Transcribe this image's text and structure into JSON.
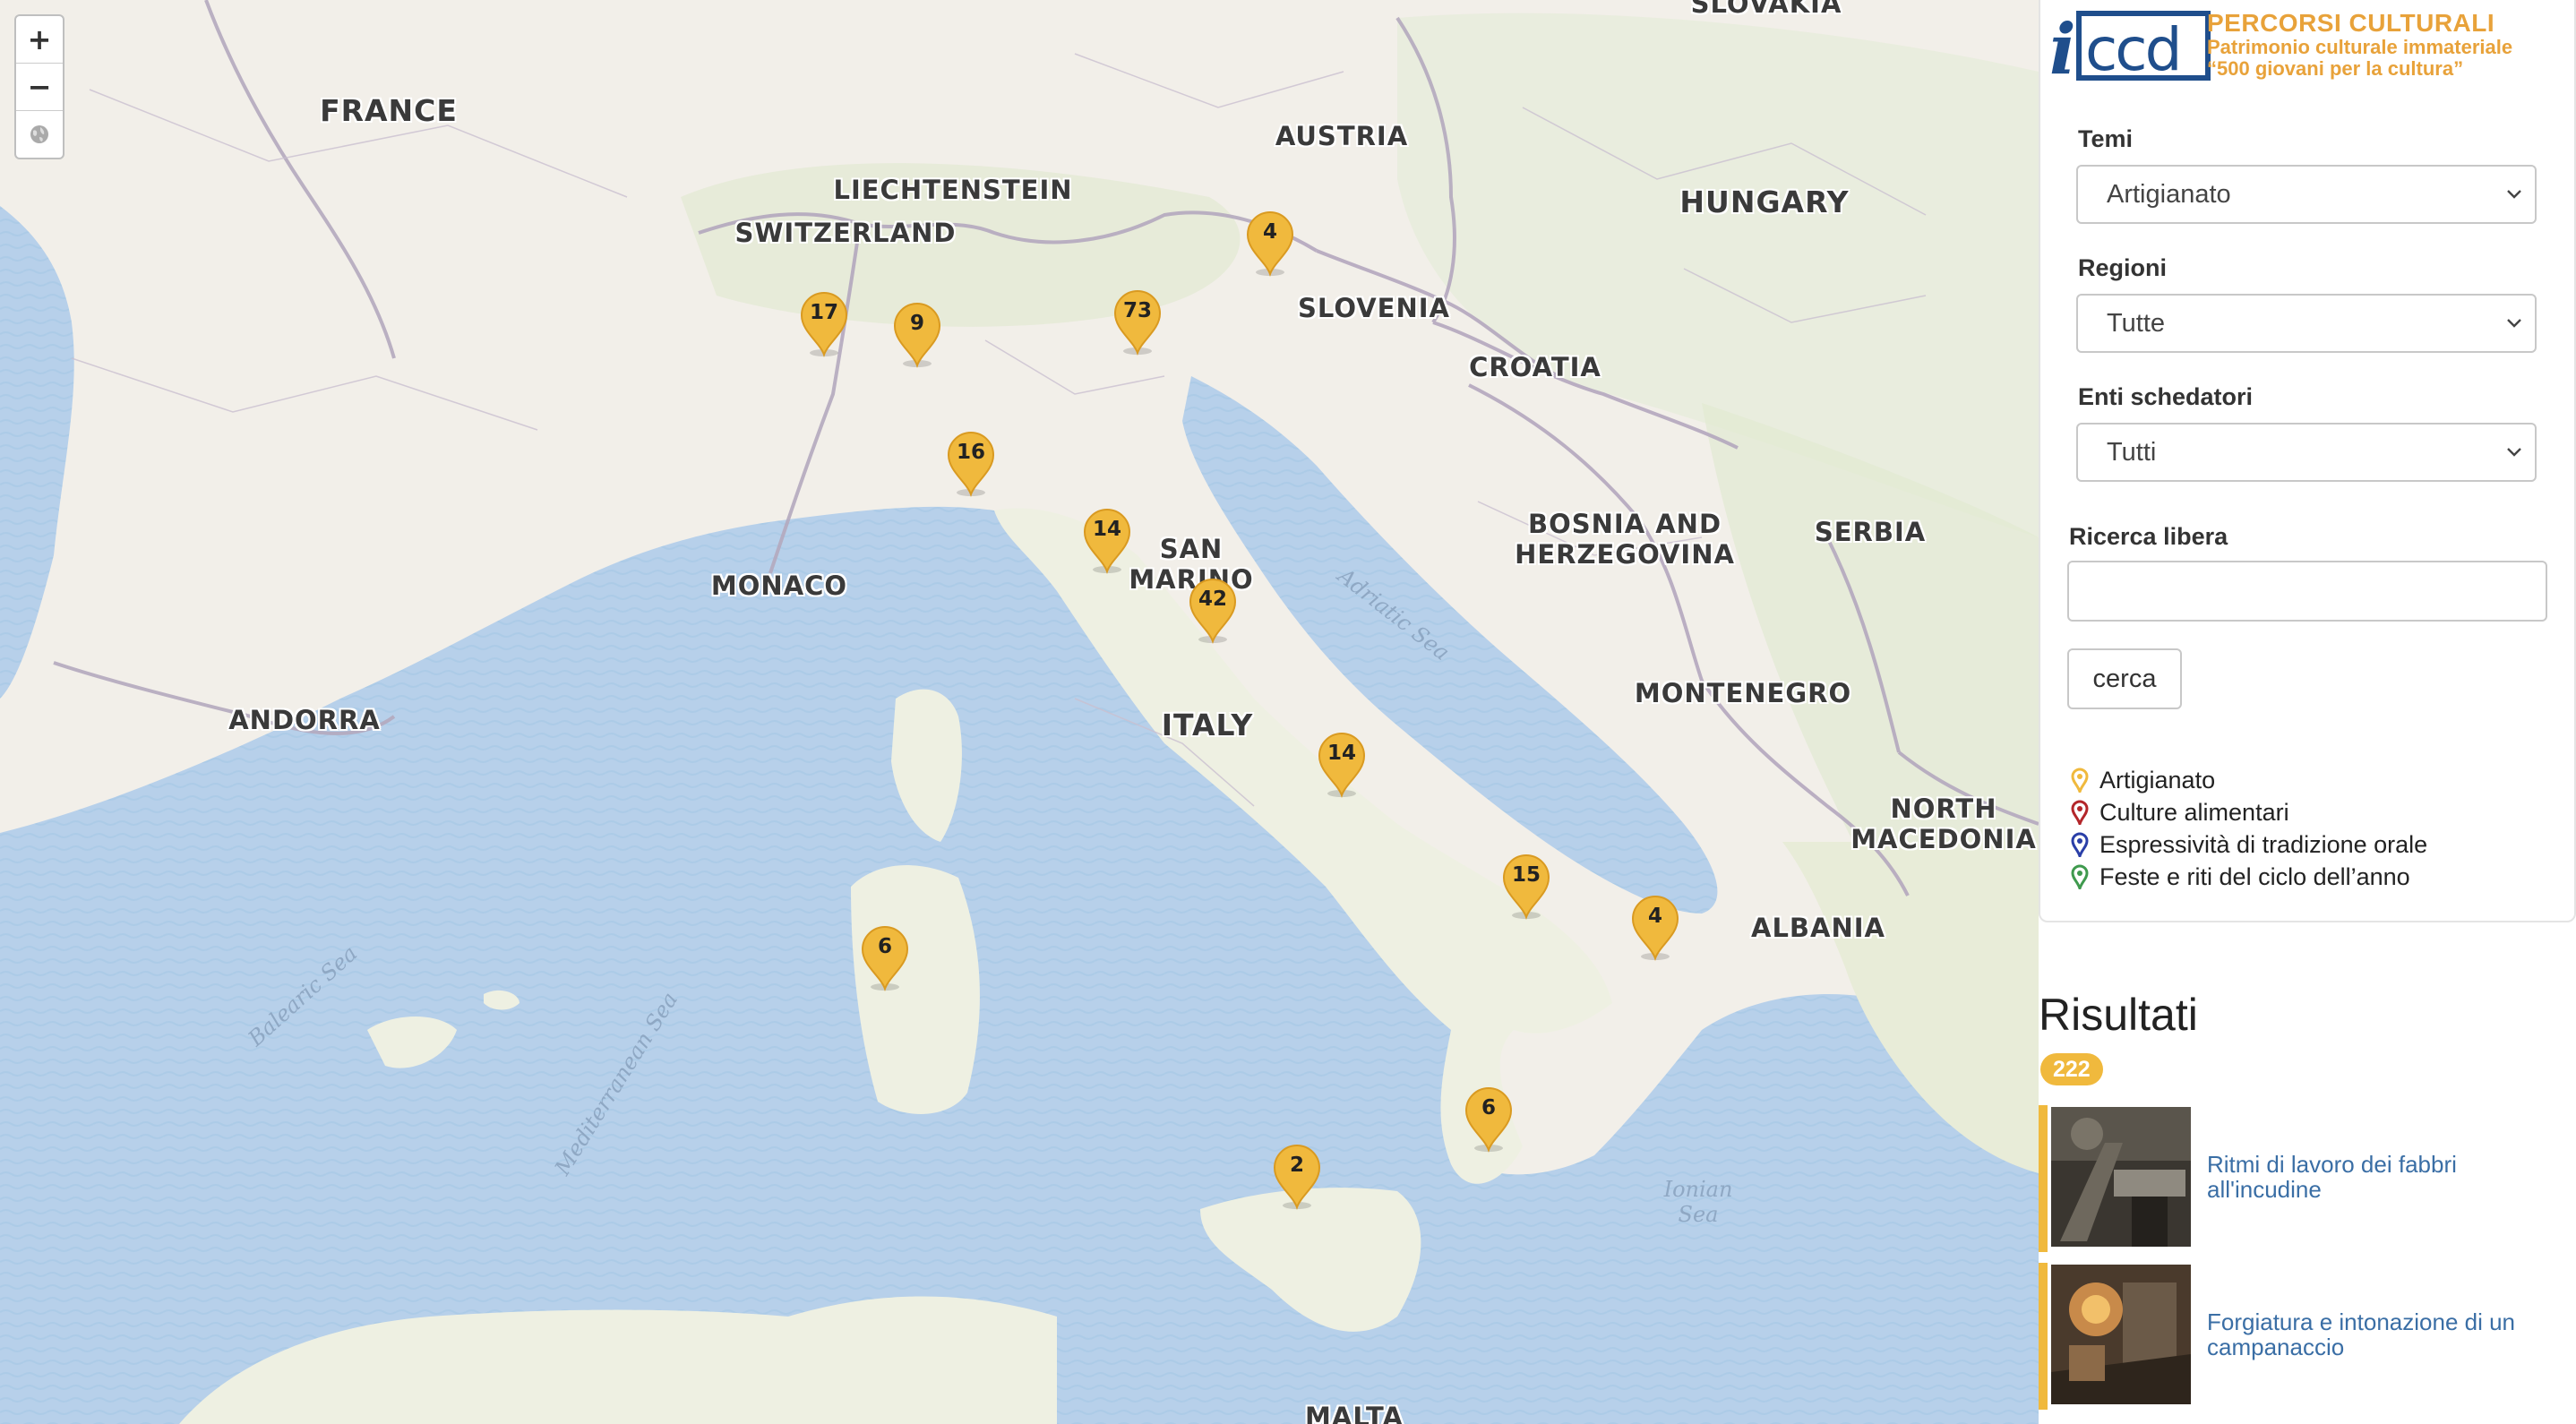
{
  "map": {
    "zoom_in_label": "+",
    "zoom_out_label": "−",
    "countries": [
      {
        "name": "FRANCE",
        "big": true
      },
      {
        "name": "SWITZERLAND"
      },
      {
        "name": "LIECHTENSTEIN"
      },
      {
        "name": "AUSTRIA"
      },
      {
        "name": "SLOVAKIA"
      },
      {
        "name": "HUNGARY",
        "big": true
      },
      {
        "name": "SLOVENIA"
      },
      {
        "name": "CROATIA"
      },
      {
        "name": "BOSNIA AND\nHERZEGOVINA"
      },
      {
        "name": "SERBIA"
      },
      {
        "name": "MONTENEGRO"
      },
      {
        "name": "NORTH\nMACEDONIA"
      },
      {
        "name": "ALBANIA"
      },
      {
        "name": "MONACO"
      },
      {
        "name": "ANDORRA"
      },
      {
        "name": "SAN\nMARINO"
      },
      {
        "name": "ITALY",
        "big": true
      },
      {
        "name": "MALTA"
      }
    ],
    "seas": [
      {
        "name": "Adriatic Sea"
      },
      {
        "name": "Balearic Sea"
      },
      {
        "name": "Mediterranean Sea"
      },
      {
        "name": "Ionian\nSea"
      }
    ],
    "markers": [
      {
        "count": "4"
      },
      {
        "count": "17"
      },
      {
        "count": "9"
      },
      {
        "count": "73"
      },
      {
        "count": "16"
      },
      {
        "count": "14"
      },
      {
        "count": "42"
      },
      {
        "count": "14"
      },
      {
        "count": "15"
      },
      {
        "count": "4"
      },
      {
        "count": "6"
      },
      {
        "count": "6"
      },
      {
        "count": "2"
      }
    ]
  },
  "brand": {
    "logo_text": "iccd",
    "title": "PERCORSI CULTURALI",
    "subtitle1": "Patrimonio culturale immateriale",
    "subtitle2": "“500 giovani per la cultura”"
  },
  "filters": {
    "temi": {
      "label": "Temi",
      "value": "Artigianato"
    },
    "regioni": {
      "label": "Regioni",
      "value": "Tutte"
    },
    "enti": {
      "label": "Enti schedatori",
      "value": "Tutti"
    },
    "search": {
      "label": "Ricerca libera",
      "value": "",
      "placeholder": ""
    },
    "search_button": "cerca"
  },
  "legend": [
    {
      "label": "Artigianato",
      "color": "#f0b93d"
    },
    {
      "label": "Culture alimentari",
      "color": "#b3262a"
    },
    {
      "label": "Espressività di tradizione orale",
      "color": "#2a3fa8"
    },
    {
      "label": "Feste e riti del ciclo dell’anno",
      "color": "#3f9a4e"
    }
  ],
  "results": {
    "title": "Risultati",
    "count": "222",
    "items": [
      {
        "title": "Ritmi di lavoro dei fabbri all'incudine"
      },
      {
        "title": "Forgiatura e intonazione di un campanaccio"
      }
    ]
  }
}
